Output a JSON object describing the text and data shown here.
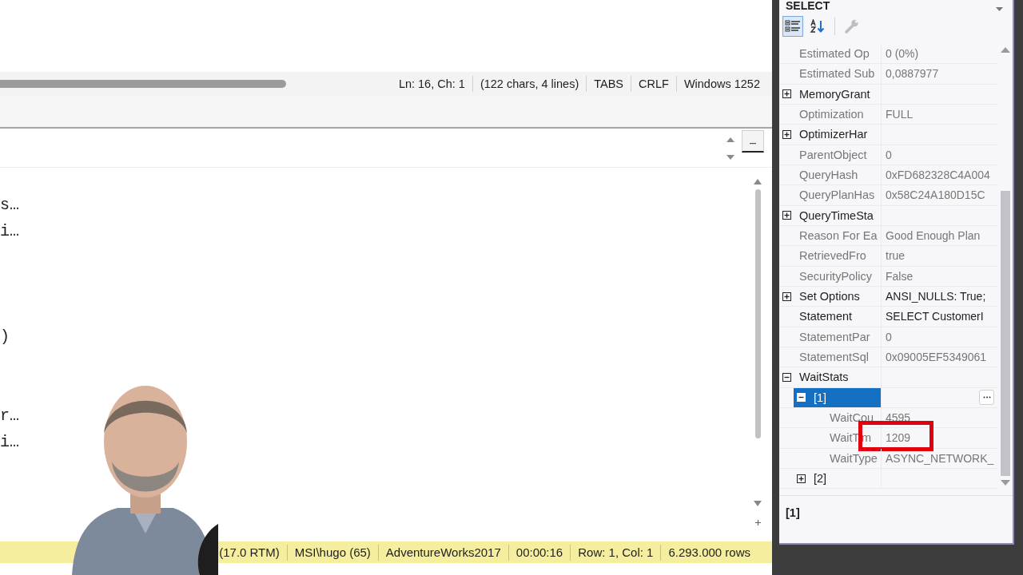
{
  "editor_status": {
    "items": [
      "Ln: 16, Ch: 1",
      "(122 chars, 4 lines)",
      "TABS",
      "CRLF",
      "Windows 1252"
    ]
  },
  "code_blocks": [
    [
      "s…",
      "i…"
    ],
    [
      ")"
    ],
    [
      "r…",
      "i…"
    ]
  ],
  "results_status": {
    "items": [
      "(17.0 RTM)",
      "MSI\\hugo (65)",
      "AdventureWorks2017",
      "00:00:16",
      "Row: 1, Col: 1",
      "6.293.000 rows"
    ]
  },
  "webcam": {
    "kind": "picture"
  },
  "properties": {
    "title": "SELECT",
    "toolbar": [
      {
        "kind": "categorized",
        "selected": true,
        "disabled": false
      },
      {
        "kind": "alphabetical",
        "selected": false,
        "disabled": false
      },
      {
        "kind": "property-pages",
        "selected": false,
        "disabled": true
      }
    ],
    "rows": [
      {
        "name": "Estimated Op",
        "value": "0 (0%)",
        "dimmed": true,
        "selected": false
      },
      {
        "name": "Estimated Sub",
        "value": "0,0887977",
        "dimmed": true,
        "selected": false
      },
      {
        "name": "MemoryGrant",
        "dimmed": false,
        "selected": false,
        "expanded": false
      },
      {
        "name": "Optimization",
        "value": "FULL",
        "dimmed": true,
        "selected": false
      },
      {
        "name": "OptimizerHar",
        "dimmed": false,
        "selected": false,
        "expanded": false
      },
      {
        "name": "ParentObject",
        "value": "0",
        "dimmed": true,
        "selected": false
      },
      {
        "name": "QueryHash",
        "value": "0xFD682328C4A004",
        "dimmed": true,
        "selected": false
      },
      {
        "name": "QueryPlanHas",
        "value": "0x58C24A180D15C",
        "dimmed": true,
        "selected": false
      },
      {
        "name": "QueryTimeSta",
        "dimmed": false,
        "selected": false,
        "expanded": false
      },
      {
        "name": "Reason For Ea",
        "value": "Good Enough Plan",
        "dimmed": true,
        "selected": false
      },
      {
        "name": "RetrievedFro",
        "value": "true",
        "dimmed": true,
        "selected": false
      },
      {
        "name": "SecurityPolicy",
        "value": "False",
        "dimmed": true,
        "selected": false
      },
      {
        "name": "Set Options",
        "value": "ANSI_NULLS: True;",
        "dimmed": false,
        "selected": false,
        "expanded": false
      },
      {
        "name": "Statement",
        "value": "SELECT  CustomerI",
        "dimmed": false,
        "selected": false
      },
      {
        "name": "StatementPar",
        "value": "0",
        "dimmed": true,
        "selected": false
      },
      {
        "name": "StatementSql",
        "value": "0x09005EF5349061",
        "dimmed": true,
        "selected": false
      },
      {
        "name": "WaitStats",
        "dimmed": false,
        "selected": false,
        "expanded": true,
        "children": [
          {
            "name": "[1]",
            "dimmed": false,
            "selected": true,
            "expanded": true,
            "has_editor": true,
            "children": [
              {
                "name": "WaitCou",
                "value": "4595",
                "dimmed": true,
                "selected": false
              },
              {
                "name": "WaitTim",
                "value": "1209",
                "dimmed": true,
                "selected": false,
                "highlighted": true
              },
              {
                "name": "WaitType",
                "value": "ASYNC_NETWORK_",
                "dimmed": true,
                "selected": false
              }
            ]
          },
          {
            "name": "[2]",
            "dimmed": false,
            "selected": false,
            "expanded": false
          }
        ]
      }
    ],
    "description": {
      "title": "[1]"
    }
  }
}
